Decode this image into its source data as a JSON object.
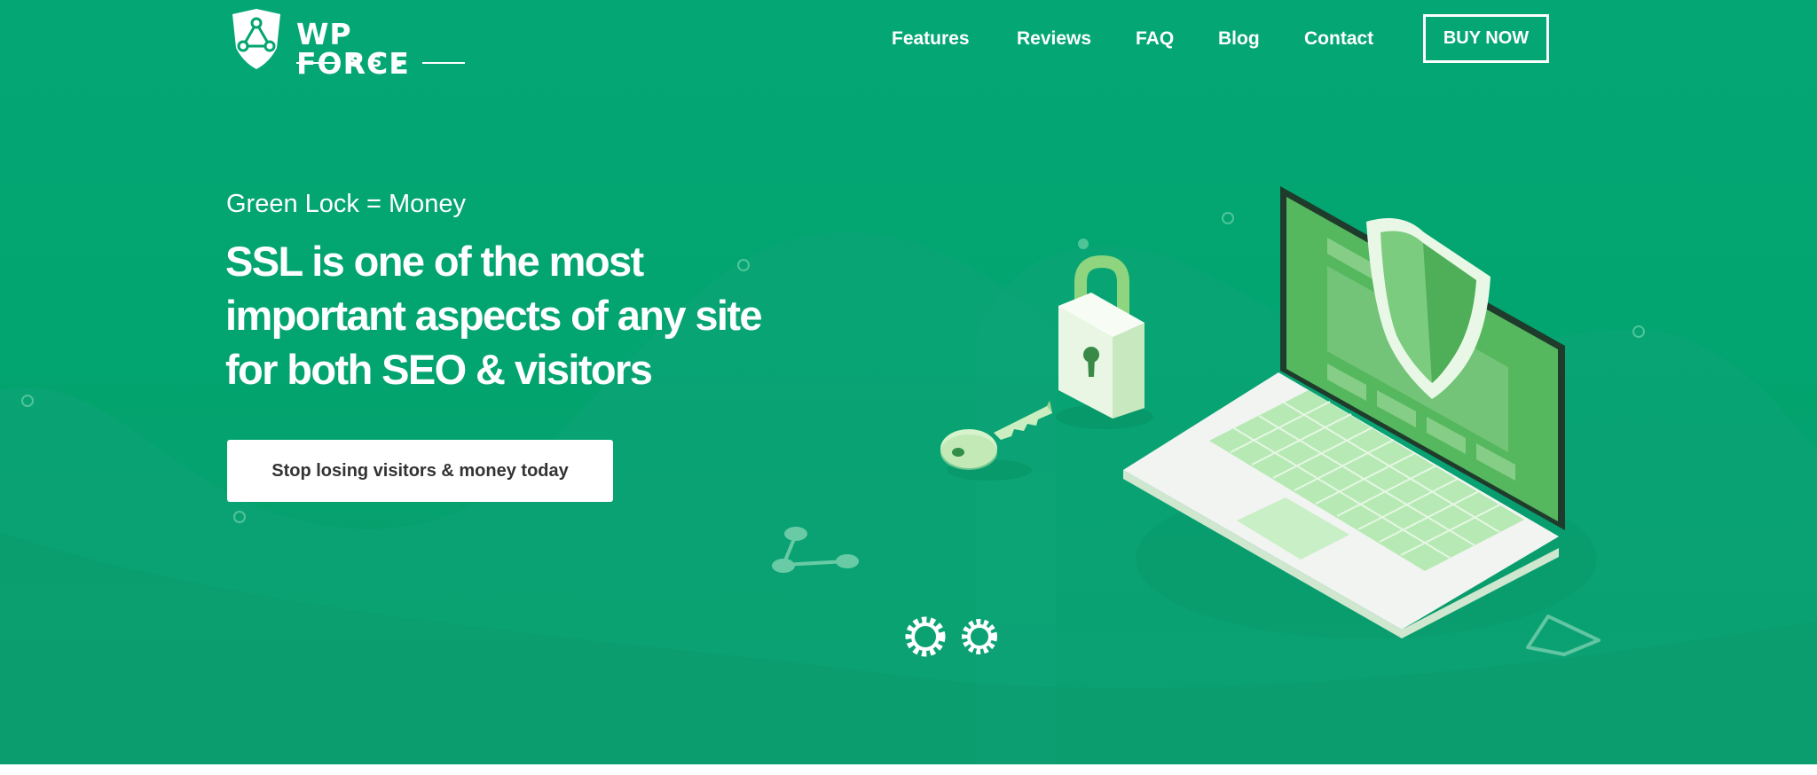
{
  "brand": {
    "name_main": "WP FORCE",
    "name_sub": "SSL"
  },
  "nav": {
    "items": [
      "Features",
      "Reviews",
      "FAQ",
      "Blog",
      "Contact"
    ],
    "buy_label": "BUY NOW"
  },
  "hero": {
    "eyebrow": "Green Lock = Money",
    "headline": "SSL is one of the most important aspects of any site for both SEO & visitors",
    "cta_label": "Stop losing visitors & money today"
  },
  "colors": {
    "background": "#02a46f",
    "text": "#ffffff",
    "cta_text": "#333333",
    "accent_light": "#d8f5d4",
    "accent_green": "#66c36a"
  },
  "icons": [
    "logo-shield-icon",
    "padlock-icon",
    "key-icon",
    "shield-icon",
    "gears-icon",
    "share-nodes-icon",
    "shield-outline-icon",
    "laptop-illustration"
  ]
}
